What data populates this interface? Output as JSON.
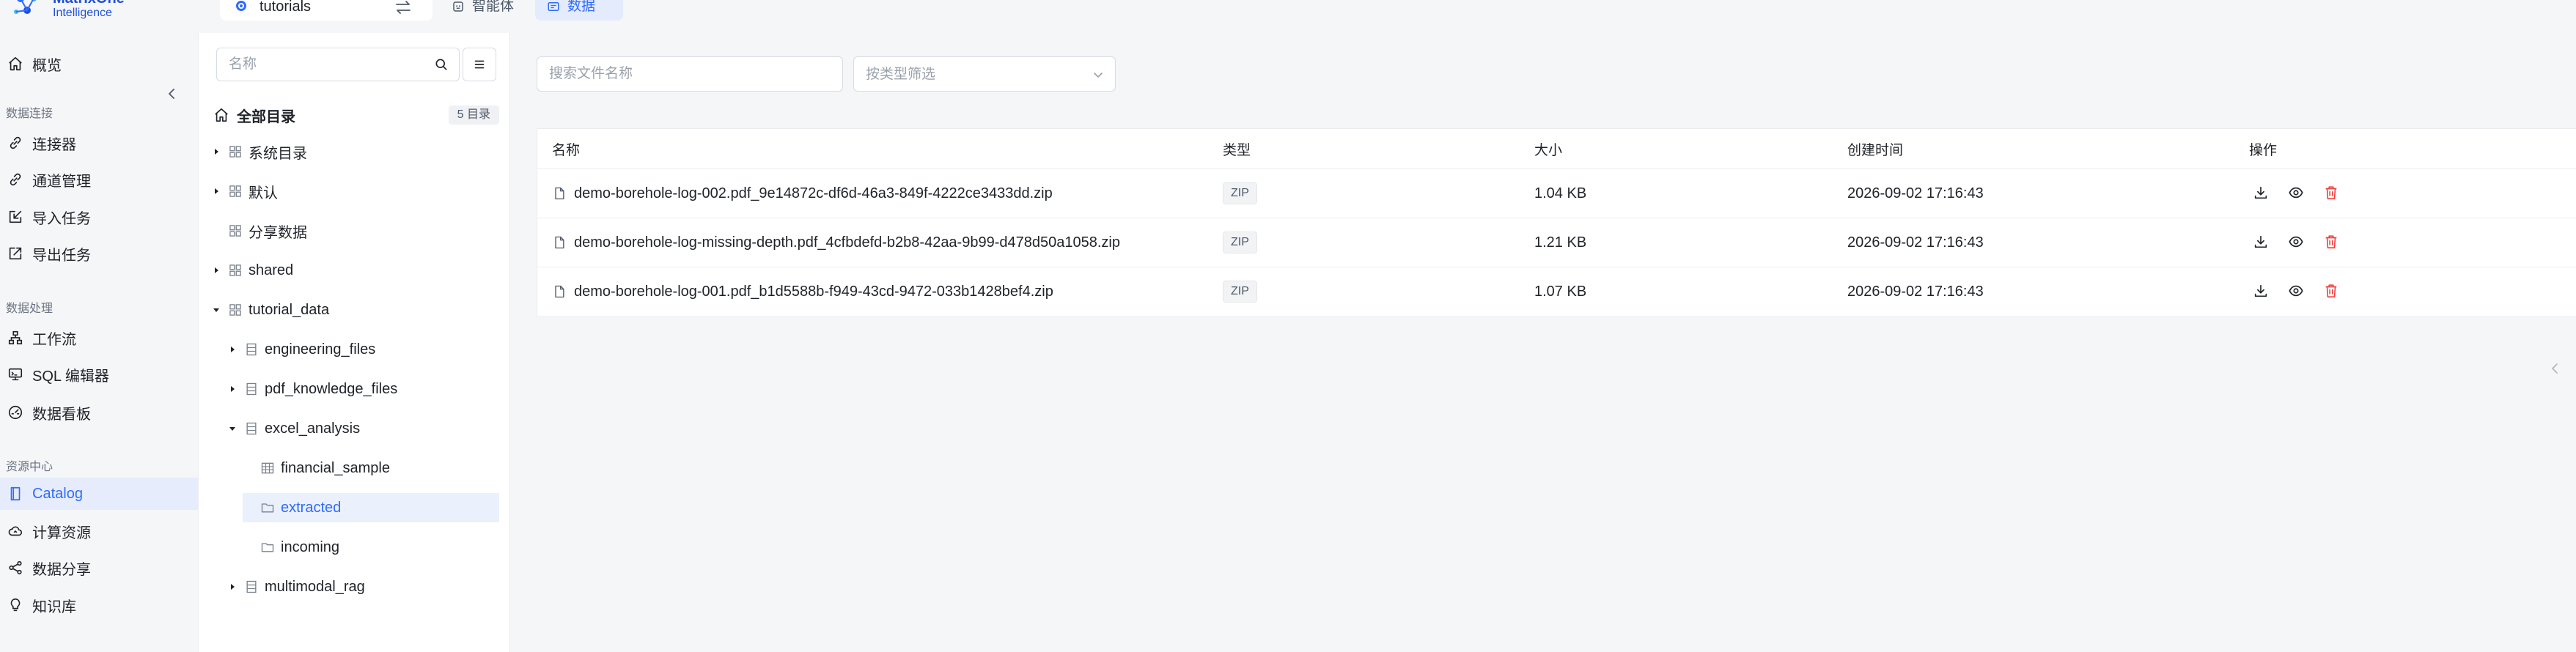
{
  "brand": {
    "line1": "MatrixOne",
    "line2": "Intelligence"
  },
  "workspace": {
    "name": "tutorials"
  },
  "top_tabs": [
    {
      "label": "智能体"
    },
    {
      "label": "数据"
    }
  ],
  "nav": {
    "overview": "概览",
    "groups": [
      "数据连接",
      "数据处理",
      "资源中心"
    ],
    "items": [
      {
        "label": "连接器",
        "icon": "link-icon"
      },
      {
        "label": "通道管理",
        "icon": "link-icon"
      },
      {
        "label": "导入任务",
        "icon": "import-icon"
      },
      {
        "label": "导出任务",
        "icon": "export-icon"
      },
      {
        "label": "工作流",
        "icon": "workflow-icon"
      },
      {
        "label": "SQL 编辑器",
        "icon": "monitor-icon"
      },
      {
        "label": "数据看板",
        "icon": "dashboard-icon"
      },
      {
        "label": "Catalog",
        "icon": "book-icon"
      },
      {
        "label": "计算资源",
        "icon": "cloud-icon"
      },
      {
        "label": "数据分享",
        "icon": "share-icon"
      },
      {
        "label": "知识库",
        "icon": "bulb-icon"
      }
    ],
    "active": "Catalog"
  },
  "tree": {
    "search_placeholder": "名称",
    "root_label": "全部目录",
    "root_badge": "5 目录",
    "nodes": [
      {
        "label": "系统目录",
        "icon": "catalog-icon",
        "caret": "right"
      },
      {
        "label": "默认",
        "icon": "catalog-icon",
        "caret": "right"
      },
      {
        "label": "分享数据",
        "icon": "catalog-icon",
        "caret": "none"
      },
      {
        "label": "shared",
        "icon": "catalog-icon",
        "caret": "right"
      },
      {
        "label": "tutorial_data",
        "icon": "catalog-icon",
        "caret": "down"
      },
      {
        "label": "engineering_files",
        "icon": "database-icon",
        "caret": "right"
      },
      {
        "label": "pdf_knowledge_files",
        "icon": "database-icon",
        "caret": "right"
      },
      {
        "label": "excel_analysis",
        "icon": "database-icon",
        "caret": "down"
      },
      {
        "label": "financial_sample",
        "icon": "table-icon",
        "caret": "none"
      },
      {
        "label": "extracted",
        "icon": "folder-icon",
        "caret": "none",
        "selected": true
      },
      {
        "label": "incoming",
        "icon": "folder-icon",
        "caret": "none"
      },
      {
        "label": "multimodal_rag",
        "icon": "database-icon",
        "caret": "right"
      }
    ]
  },
  "filters": {
    "search_placeholder": "搜索文件名称",
    "type_placeholder": "按类型筛选"
  },
  "table": {
    "columns": [
      "名称",
      "类型",
      "大小",
      "创建时间",
      "操作"
    ],
    "rows": [
      {
        "name": "demo-borehole-log-002.pdf_9e14872c-df6d-46a3-849f-4222ce3433dd.zip",
        "type": "ZIP",
        "size": "1.04 KB",
        "created": "2026-09-02 17:16:43"
      },
      {
        "name": "demo-borehole-log-missing-depth.pdf_4cfbdefd-b2b8-42aa-9b99-d478d50a1058.zip",
        "type": "ZIP",
        "size": "1.21 KB",
        "created": "2026-09-02 17:16:43"
      },
      {
        "name": "demo-borehole-log-001.pdf_b1d5588b-f949-43cd-9472-033b1428bef4.zip",
        "type": "ZIP",
        "size": "1.07 KB",
        "created": "2026-09-02 17:16:43"
      }
    ]
  },
  "colors": {
    "accent": "#2f6bff",
    "danger": "#f53f3f",
    "active_bg": "#e6ecfb"
  }
}
